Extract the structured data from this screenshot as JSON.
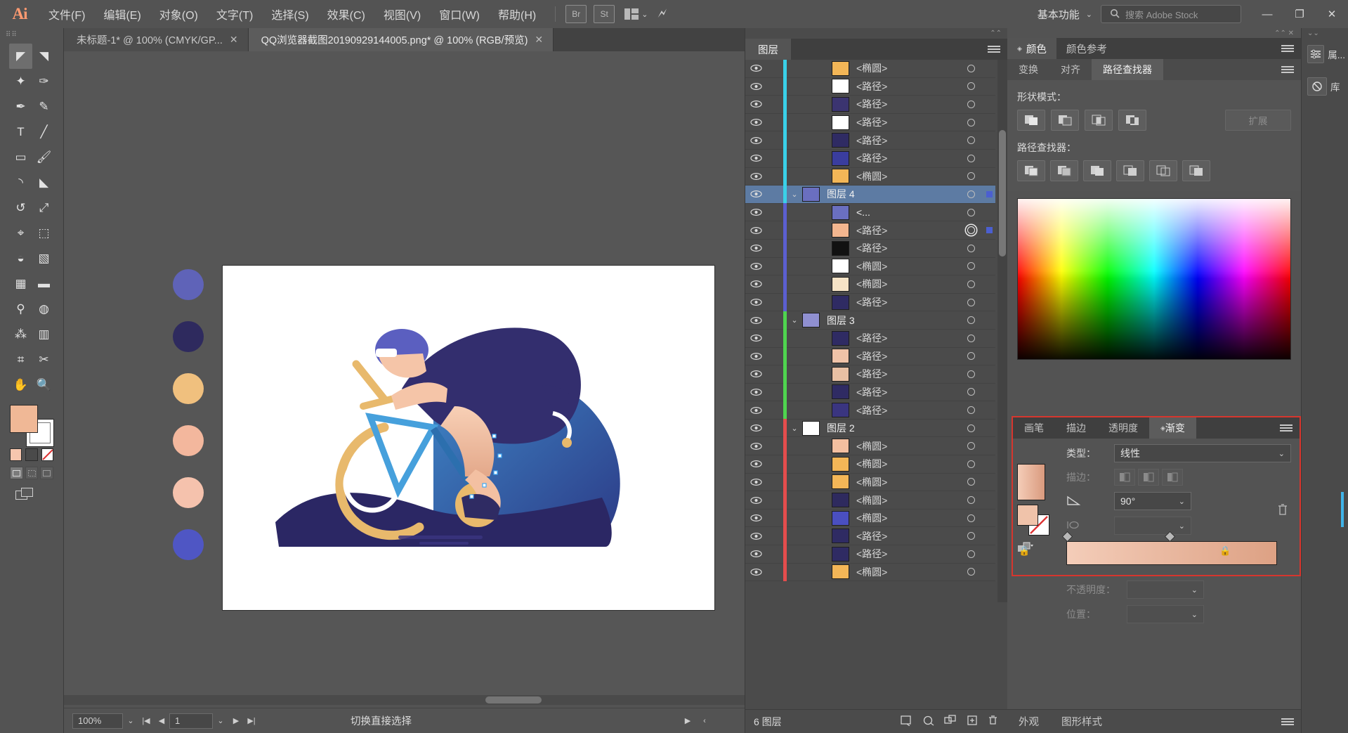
{
  "app": {
    "name": "Adobe Illustrator",
    "logo": "Ai"
  },
  "menubar": {
    "items": [
      {
        "label": "文件(F)",
        "name": "menu-file"
      },
      {
        "label": "编辑(E)",
        "name": "menu-edit"
      },
      {
        "label": "对象(O)",
        "name": "menu-object"
      },
      {
        "label": "文字(T)",
        "name": "menu-type"
      },
      {
        "label": "选择(S)",
        "name": "menu-select"
      },
      {
        "label": "效果(C)",
        "name": "menu-effect"
      },
      {
        "label": "视图(V)",
        "name": "menu-view"
      },
      {
        "label": "窗口(W)",
        "name": "menu-window"
      },
      {
        "label": "帮助(H)",
        "name": "menu-help"
      }
    ],
    "bridge_label": "Br",
    "stock_label": "St",
    "workspace": "基本功能",
    "search_placeholder": "搜索 Adobe Stock",
    "window_minimize": "—",
    "window_restore": "❐",
    "window_close": "✕"
  },
  "tabs": [
    {
      "title": "未标题-1* @ 100% (CMYK/GP...",
      "active": false,
      "close": "✕"
    },
    {
      "title": "QQ浏览器截图20190929144005.png* @ 100% (RGB/预览)",
      "active": true,
      "close": "✕"
    }
  ],
  "toolbar": {
    "grip": "⠿⠿",
    "tools": [
      {
        "name": "selection-tool",
        "glyph": "◤",
        "selected": true
      },
      {
        "name": "direct-selection-tool",
        "glyph": "◥",
        "selected": false
      },
      {
        "name": "magic-wand-tool",
        "glyph": "✦",
        "selected": false
      },
      {
        "name": "lasso-tool",
        "glyph": "✑",
        "selected": false
      },
      {
        "name": "pen-tool",
        "glyph": "✒",
        "selected": false
      },
      {
        "name": "curvature-tool",
        "glyph": "✎",
        "selected": false
      },
      {
        "name": "type-tool",
        "glyph": "T",
        "selected": false
      },
      {
        "name": "line-segment-tool",
        "glyph": "╱",
        "selected": false
      },
      {
        "name": "rectangle-tool",
        "glyph": "▭",
        "selected": false
      },
      {
        "name": "paintbrush-tool",
        "glyph": "🖌",
        "selected": false
      },
      {
        "name": "shaper-tool",
        "glyph": "◝",
        "selected": false
      },
      {
        "name": "eraser-tool",
        "glyph": "◣",
        "selected": false
      },
      {
        "name": "rotate-tool",
        "glyph": "↺",
        "selected": false
      },
      {
        "name": "scale-tool",
        "glyph": "⤢",
        "selected": false
      },
      {
        "name": "width-tool",
        "glyph": "⌖",
        "selected": false
      },
      {
        "name": "free-transform-tool",
        "glyph": "⬚",
        "selected": false
      },
      {
        "name": "shape-builder-tool",
        "glyph": "◒",
        "selected": false
      },
      {
        "name": "perspective-grid-tool",
        "glyph": "▧",
        "selected": false
      },
      {
        "name": "mesh-tool",
        "glyph": "▦",
        "selected": false
      },
      {
        "name": "gradient-tool",
        "glyph": "▬",
        "selected": false
      },
      {
        "name": "eyedropper-tool",
        "glyph": "⚲",
        "selected": false
      },
      {
        "name": "blend-tool",
        "glyph": "◍",
        "selected": false
      },
      {
        "name": "symbol-sprayer-tool",
        "glyph": "⁂",
        "selected": false
      },
      {
        "name": "column-graph-tool",
        "glyph": "▥",
        "selected": false
      },
      {
        "name": "artboard-tool",
        "glyph": "⌗",
        "selected": false
      },
      {
        "name": "slice-tool",
        "glyph": "✂",
        "selected": false
      },
      {
        "name": "hand-tool",
        "glyph": "✋",
        "selected": false
      },
      {
        "name": "zoom-tool",
        "glyph": "🔍",
        "selected": false
      }
    ],
    "fill_color": "#f0b896",
    "stroke_color": "#ffffff",
    "mini_swatches": [
      "#f6c6ae",
      "#4a4a4a",
      "none"
    ]
  },
  "canvas": {
    "zoom_level": "100%",
    "artboard_background": "#ffffff",
    "palette_circles": [
      "#5f63b8",
      "#2e2a5e",
      "#f0c07e",
      "#f3b79d",
      "#f5c2ad",
      "#4f56c4"
    ]
  },
  "statusbar": {
    "zoom": "100%",
    "page_number": "1",
    "status_text": "切换直接选择",
    "first": "|◀",
    "prev": "◀",
    "next": "▶",
    "last": "▶|",
    "play": "▶",
    "left_chevron": "‹",
    "right_chevron": "›"
  },
  "layers_panel": {
    "tab_label": "图层",
    "footer_count": "6 图层",
    "footer_icons": [
      "locate-object-icon",
      "make-clipping-mask-icon",
      "create-new-sublayer-icon",
      "create-new-layer-icon",
      "delete-selection-icon"
    ],
    "rows": [
      {
        "name": "<椭圆>",
        "type": "path",
        "indent": 1,
        "color": "#3ad0e8",
        "thumb": "#f3b657",
        "target": "single",
        "sq": false,
        "expandable": false,
        "selected": false
      },
      {
        "name": "<路径>",
        "type": "path",
        "indent": 1,
        "color": "#3ad0e8",
        "thumb": "#ffffff",
        "target": "single",
        "sq": false,
        "expandable": false,
        "selected": false
      },
      {
        "name": "<路径>",
        "type": "path",
        "indent": 1,
        "color": "#3ad0e8",
        "thumb": "#3b3470",
        "target": "single",
        "sq": false,
        "expandable": false,
        "selected": false
      },
      {
        "name": "<路径>",
        "type": "path",
        "indent": 1,
        "color": "#3ad0e8",
        "thumb": "#ffffff",
        "target": "single",
        "sq": false,
        "expandable": false,
        "selected": false
      },
      {
        "name": "<路径>",
        "type": "path",
        "indent": 1,
        "color": "#3ad0e8",
        "thumb": "#2f2b63",
        "target": "single",
        "sq": false,
        "expandable": false,
        "selected": false
      },
      {
        "name": "<路径>",
        "type": "path",
        "indent": 1,
        "color": "#3ad0e8",
        "thumb": "#3a3d9e",
        "target": "single",
        "sq": false,
        "expandable": false,
        "selected": false
      },
      {
        "name": "<椭圆>",
        "type": "path",
        "indent": 1,
        "color": "#3ad0e8",
        "thumb": "#f3b657",
        "target": "single",
        "sq": false,
        "expandable": false,
        "selected": false
      },
      {
        "name": "图层 4",
        "type": "layer",
        "indent": 0,
        "color": "#3ad0e8",
        "thumb": "#6a6fc0",
        "target": "single",
        "sq": true,
        "expandable": true,
        "selected": true
      },
      {
        "name": "<...",
        "type": "group",
        "indent": 1,
        "color": "#5b5fd0",
        "thumb": "#6a6fc0",
        "target": "single",
        "sq": false,
        "expandable": false,
        "selected": false
      },
      {
        "name": "<路径>",
        "type": "path",
        "indent": 1,
        "color": "#5b5fd0",
        "thumb": "#f3b68f",
        "target": "double",
        "sq": true,
        "expandable": false,
        "selected": false
      },
      {
        "name": "<路径>",
        "type": "path",
        "indent": 1,
        "color": "#5b5fd0",
        "thumb": "#111111",
        "target": "single",
        "sq": false,
        "expandable": false,
        "selected": false
      },
      {
        "name": "<椭圆>",
        "type": "path",
        "indent": 1,
        "color": "#5b5fd0",
        "thumb": "#ffffff",
        "target": "single",
        "sq": false,
        "expandable": false,
        "selected": false
      },
      {
        "name": "<椭圆>",
        "type": "path",
        "indent": 1,
        "color": "#5b5fd0",
        "thumb": "#f6e3c6",
        "target": "single",
        "sq": false,
        "expandable": false,
        "selected": false
      },
      {
        "name": "<路径>",
        "type": "path",
        "indent": 1,
        "color": "#5b5fd0",
        "thumb": "#2f2b63",
        "target": "single",
        "sq": false,
        "expandable": false,
        "selected": false
      },
      {
        "name": "图层 3",
        "type": "layer",
        "indent": 0,
        "color": "#4fd44f",
        "thumb": "#8f8fd0",
        "target": "single",
        "sq": false,
        "expandable": true,
        "selected": false
      },
      {
        "name": "<路径>",
        "type": "path",
        "indent": 1,
        "color": "#4fd44f",
        "thumb": "#2f2b63",
        "target": "single",
        "sq": false,
        "expandable": false,
        "selected": false
      },
      {
        "name": "<路径>",
        "type": "path",
        "indent": 1,
        "color": "#4fd44f",
        "thumb": "#f0c3a8",
        "target": "single",
        "sq": false,
        "expandable": false,
        "selected": false
      },
      {
        "name": "<路径>",
        "type": "path",
        "indent": 1,
        "color": "#4fd44f",
        "thumb": "#e8c0a4",
        "target": "single",
        "sq": false,
        "expandable": false,
        "selected": false
      },
      {
        "name": "<路径>",
        "type": "path",
        "indent": 1,
        "color": "#4fd44f",
        "thumb": "#2f2b63",
        "target": "single",
        "sq": false,
        "expandable": false,
        "selected": false
      },
      {
        "name": "<路径>",
        "type": "path",
        "indent": 1,
        "color": "#4fd44f",
        "thumb": "#3a3580",
        "target": "single",
        "sq": false,
        "expandable": false,
        "selected": false
      },
      {
        "name": "图层 2",
        "type": "layer",
        "indent": 0,
        "color": "#e44d4d",
        "thumb": "#ffffff",
        "target": "single",
        "sq": false,
        "expandable": true,
        "selected": false
      },
      {
        "name": "<椭圆>",
        "type": "path",
        "indent": 1,
        "color": "#e44d4d",
        "thumb": "#f3bfa0",
        "target": "single",
        "sq": false,
        "expandable": false,
        "selected": false
      },
      {
        "name": "<椭圆>",
        "type": "path",
        "indent": 1,
        "color": "#e44d4d",
        "thumb": "#f3b657",
        "target": "single",
        "sq": false,
        "expandable": false,
        "selected": false
      },
      {
        "name": "<椭圆>",
        "type": "path",
        "indent": 1,
        "color": "#e44d4d",
        "thumb": "#f3b657",
        "target": "single",
        "sq": false,
        "expandable": false,
        "selected": false
      },
      {
        "name": "<椭圆>",
        "type": "path",
        "indent": 1,
        "color": "#e44d4d",
        "thumb": "#2e2a5e",
        "target": "single",
        "sq": false,
        "expandable": false,
        "selected": false
      },
      {
        "name": "<椭圆>",
        "type": "path",
        "indent": 1,
        "color": "#e44d4d",
        "thumb": "#4a4fc0",
        "target": "single",
        "sq": false,
        "expandable": false,
        "selected": false
      },
      {
        "name": "<路径>",
        "type": "path",
        "indent": 1,
        "color": "#e44d4d",
        "thumb": "#2f2b63",
        "target": "single",
        "sq": false,
        "expandable": false,
        "selected": false
      },
      {
        "name": "<路径>",
        "type": "path",
        "indent": 1,
        "color": "#e44d4d",
        "thumb": "#2f2b63",
        "target": "single",
        "sq": false,
        "expandable": false,
        "selected": false
      },
      {
        "name": "<椭圆>",
        "type": "path",
        "indent": 1,
        "color": "#e44d4d",
        "thumb": "#f3b657",
        "target": "single",
        "sq": false,
        "expandable": false,
        "selected": false
      }
    ]
  },
  "color_panel": {
    "tabs": [
      {
        "label": "颜色",
        "active": true
      },
      {
        "label": "颜色参考",
        "active": false
      }
    ]
  },
  "pathfinder_panel": {
    "tabs": [
      {
        "label": "变换",
        "active": false
      },
      {
        "label": "对齐",
        "active": false
      },
      {
        "label": "路径查找器",
        "active": true
      }
    ],
    "shape_modes_label": "形状模式：",
    "pathfinder_label": "路径查找器：",
    "expand_label": "扩展",
    "shape_mode_buttons": [
      "unite-icon",
      "minus-front-icon",
      "intersect-icon",
      "exclude-icon"
    ],
    "pathfinder_buttons": [
      "divide-icon",
      "trim-icon",
      "merge-icon",
      "crop-icon",
      "outline-icon",
      "minus-back-icon"
    ]
  },
  "gradient_panel": {
    "tabs": [
      {
        "label": "画笔",
        "active": false
      },
      {
        "label": "描边",
        "active": false
      },
      {
        "label": "透明度",
        "active": false
      },
      {
        "label": "渐变",
        "active": true
      }
    ],
    "type_label": "类型：",
    "type_value": "线性",
    "stroke_label": "描边：",
    "angle_label": "angle-icon",
    "angle_value": "90°",
    "aspect_label": "aspect-ratio-icon",
    "aspect_value": "",
    "opacity_label": "不透明度：",
    "opacity_value": "",
    "location_label": "位置：",
    "location_value": "",
    "gradient_start_color": "#f4cdb9",
    "gradient_end_color": "#dda184",
    "delete_stop_icon": "trash-icon",
    "highlight_border_color": "#d6362e"
  },
  "appearance_tabs": [
    {
      "label": "外观",
      "active": false
    },
    {
      "label": "图形样式",
      "active": false
    }
  ],
  "far_dock": {
    "items": [
      {
        "label": "属...",
        "icon": "properties-icon"
      },
      {
        "label": "库",
        "icon": "libraries-icon"
      }
    ]
  }
}
